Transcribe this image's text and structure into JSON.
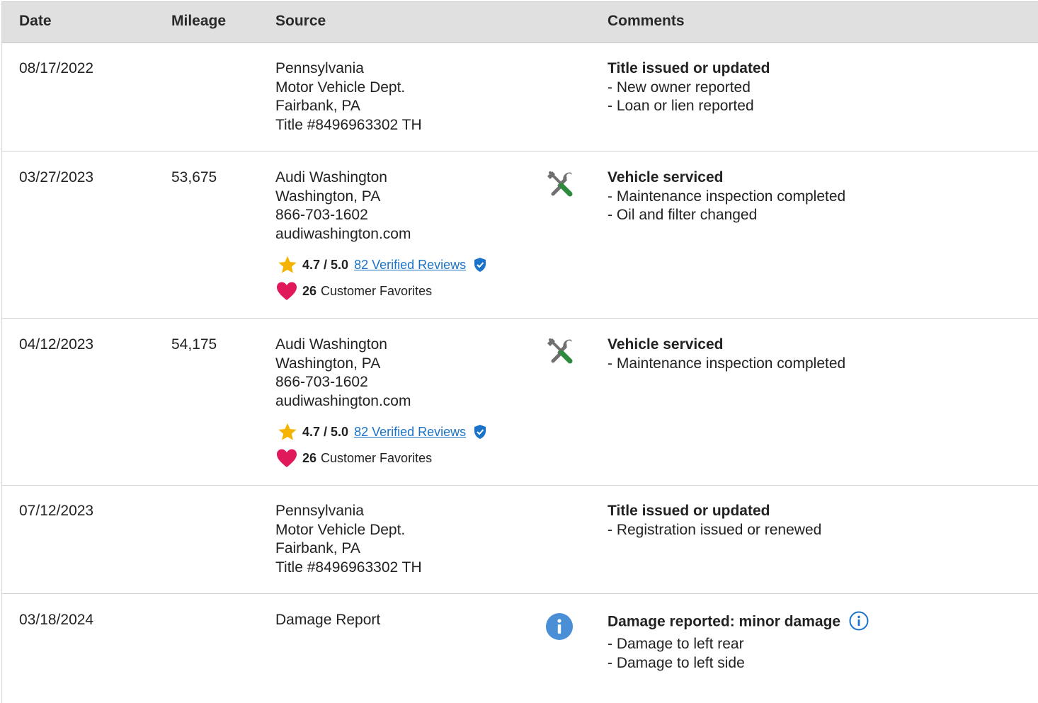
{
  "header": {
    "date": "Date",
    "mileage": "Mileage",
    "source": "Source",
    "comments": "Comments"
  },
  "colors": {
    "header_bg": "#e0e0e0",
    "link": "#1a73c9",
    "star": "#f5b301",
    "heart": "#e0195a",
    "wrench_green": "#2e8b3d",
    "info_blue": "#4a8fd6"
  },
  "rows": [
    {
      "date": "08/17/2022",
      "mileage": "",
      "source": [
        "Pennsylvania",
        "Motor Vehicle Dept.",
        "Fairbank, PA",
        "Title #8496963302 TH"
      ],
      "comments": {
        "title": "Title issued or updated",
        "items": [
          "- New owner reported",
          "- Loan or lien reported"
        ]
      }
    },
    {
      "date": "03/27/2023",
      "mileage": "53,675",
      "source": [
        "Audi Washington",
        "Washington, PA",
        "866-703-1602",
        "audiwashington.com"
      ],
      "rating": {
        "score": "4.7 / 5.0",
        "reviews": "82 Verified Reviews"
      },
      "favorites": {
        "count": "26",
        "label": "Customer Favorites"
      },
      "icon": "wrench-screwdriver-icon",
      "comments": {
        "title": "Vehicle serviced",
        "items": [
          "- Maintenance inspection completed",
          "- Oil and filter changed"
        ]
      }
    },
    {
      "date": "04/12/2023",
      "mileage": "54,175",
      "source": [
        "Audi Washington",
        "Washington, PA",
        "866-703-1602",
        "audiwashington.com"
      ],
      "rating": {
        "score": "4.7 / 5.0",
        "reviews": "82 Verified Reviews"
      },
      "favorites": {
        "count": "26",
        "label": "Customer Favorites"
      },
      "icon": "wrench-screwdriver-icon",
      "comments": {
        "title": "Vehicle serviced",
        "items": [
          "- Maintenance inspection completed"
        ]
      }
    },
    {
      "date": "07/12/2023",
      "mileage": "",
      "source": [
        "Pennsylvania",
        "Motor Vehicle Dept.",
        "Fairbank, PA",
        "Title #8496963302 TH"
      ],
      "comments": {
        "title": "Title issued or updated",
        "items": [
          "- Registration issued or renewed"
        ]
      }
    },
    {
      "date": "03/18/2024",
      "mileage": "",
      "source": [
        "Damage Report"
      ],
      "icon": "info-icon",
      "comments": {
        "title": "Damage reported: minor damage",
        "items": [
          "- Damage to left rear",
          "- Damage to left side"
        ]
      }
    }
  ]
}
